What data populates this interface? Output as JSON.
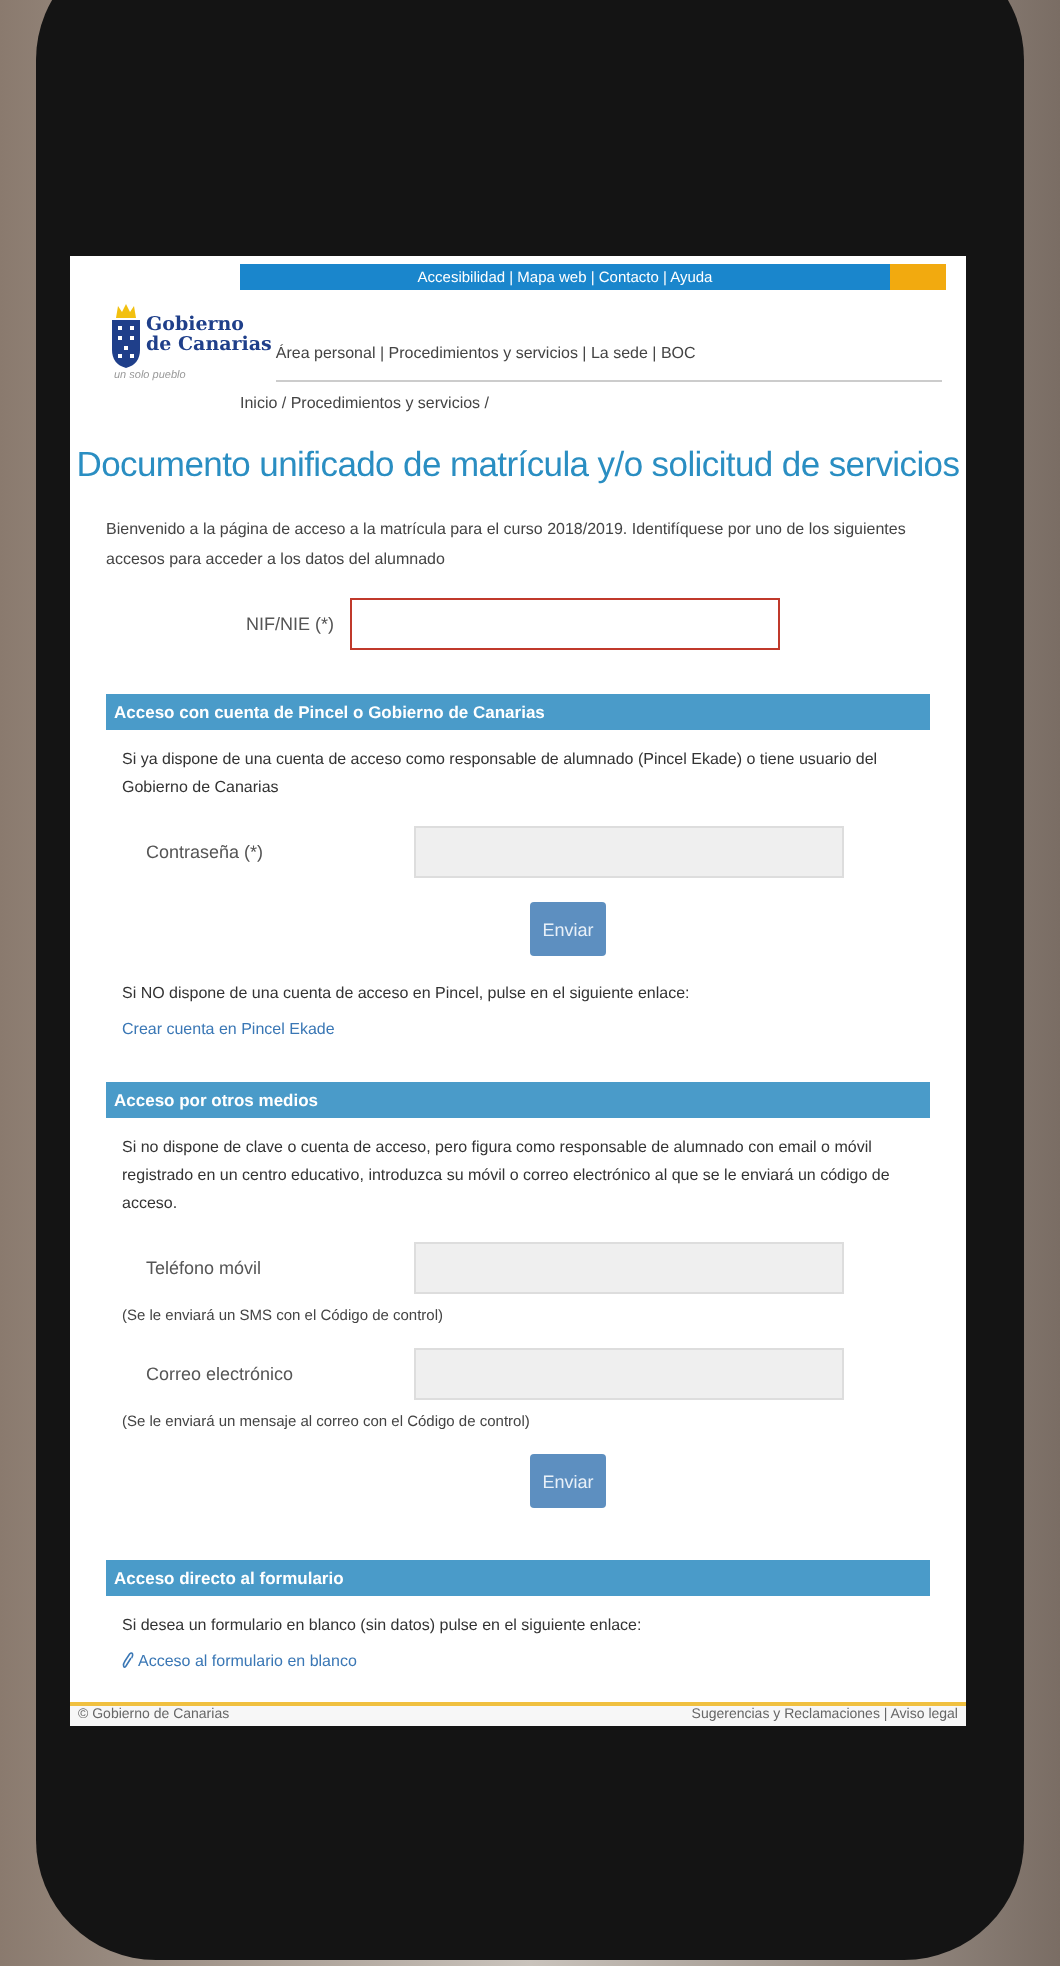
{
  "top_bar": {
    "links": "Accesibilidad | Mapa web | Contacto | Ayuda"
  },
  "logo": {
    "line_1": "Gobierno",
    "line_2": "de Canarias",
    "tagline": "un solo pueblo"
  },
  "nav": "Área personal | Procedimientos y servicios | La sede | BOC",
  "breadcrumb": "Inicio / Procedimientos y servicios /",
  "title": "Documento unificado de matrícula y/o solicitud de servicios",
  "intro": "Bienvenido a la página de acceso a la matrícula para el curso 2018/2019. Identifíquese por uno de los siguientes accesos para acceder a los datos del alumnado",
  "id_field": {
    "label": "NIF/NIE (*)",
    "invalid": true
  },
  "sections": [
    {
      "title": "Acceso con cuenta de Pincel o Gobierno de Canarias",
      "blocks": [
        {
          "kind": "text",
          "text": "Si ya dispone de una cuenta de acceso como responsable de alumnado (Pincel Ekade) o tiene usuario del Gobierno de Canarias"
        },
        {
          "kind": "field",
          "label": "Contraseña (*)",
          "invalid": false
        },
        {
          "kind": "button",
          "label": "Enviar"
        },
        {
          "kind": "text",
          "text": "Si NO dispone de una cuenta de acceso en Pincel, pulse en el siguiente enlace:"
        },
        {
          "kind": "link",
          "text": "Crear cuenta en Pincel Ekade"
        }
      ]
    },
    {
      "title": "Acceso por otros medios",
      "blocks": [
        {
          "kind": "text",
          "text": "Si no dispone de clave o cuenta de acceso, pero figura como responsable de alumnado con email o móvil registrado en un centro educativo, introduzca su móvil o correo electrónico al que se le enviará un código de acceso."
        },
        {
          "kind": "field",
          "label": "Teléfono móvil",
          "invalid": false
        },
        {
          "kind": "note",
          "text": "(Se le enviará un SMS con el Código de control)"
        },
        {
          "kind": "field",
          "label": "Correo electrónico",
          "invalid": false
        },
        {
          "kind": "note",
          "text": "(Se le enviará un mensaje al correo con el Código de control)"
        },
        {
          "kind": "button",
          "label": "Enviar"
        }
      ]
    },
    {
      "title": "Acceso directo al formulario",
      "blocks": [
        {
          "kind": "text",
          "text": "Si desea un formulario en blanco (sin datos) pulse en el siguiente enlace:"
        },
        {
          "kind": "clip_link",
          "text": "Acceso al formulario en blanco"
        }
      ]
    }
  ],
  "footer": {
    "left": "© Gobierno de Canarias",
    "right": "Sugerencias y Reclamaciones | Aviso legal"
  }
}
